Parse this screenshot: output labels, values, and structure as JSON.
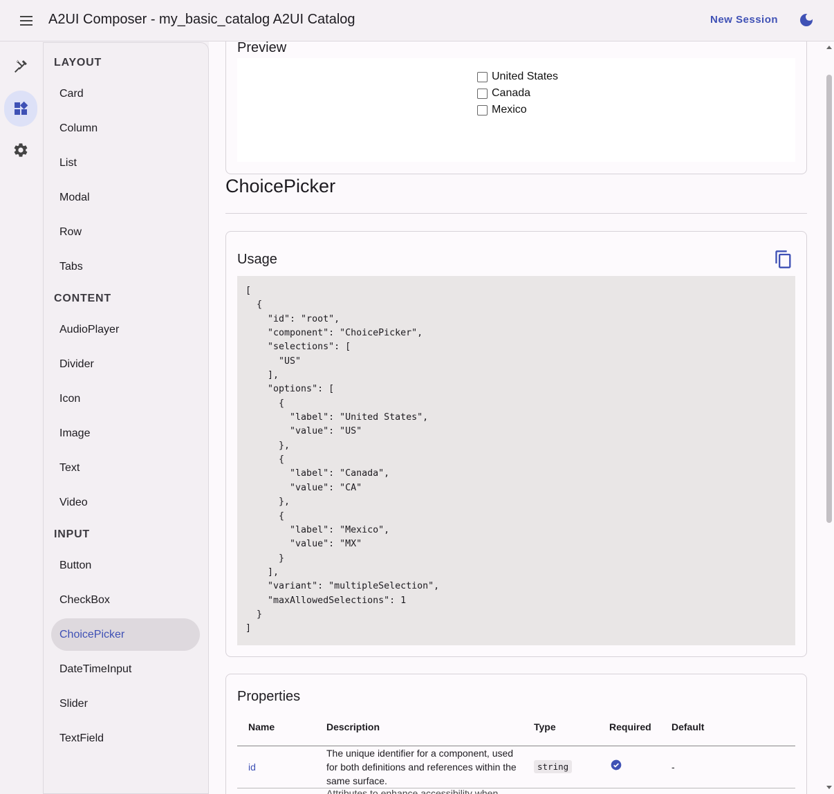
{
  "app": {
    "title": "A2UI Composer - my_basic_catalog A2UI Catalog",
    "new_session_label": "New Session",
    "menu_icon": "menu-icon",
    "theme_icon": "dark-mode-icon"
  },
  "rail": {
    "items": [
      {
        "icon": "tools-icon",
        "active": false
      },
      {
        "icon": "widgets-icon",
        "active": true
      },
      {
        "icon": "settings-icon",
        "active": false
      }
    ]
  },
  "sidebar": {
    "sections": [
      {
        "label": "LAYOUT",
        "items": [
          "Card",
          "Column",
          "List",
          "Modal",
          "Row",
          "Tabs"
        ]
      },
      {
        "label": "CONTENT",
        "items": [
          "AudioPlayer",
          "Divider",
          "Icon",
          "Image",
          "Text",
          "Video"
        ]
      },
      {
        "label": "INPUT",
        "items": [
          "Button",
          "CheckBox",
          "ChoicePicker",
          "DateTimeInput",
          "Slider",
          "TextField"
        ]
      }
    ],
    "active_item": "ChoicePicker"
  },
  "preview": {
    "title": "Preview",
    "options": [
      "United States",
      "Canada",
      "Mexico"
    ]
  },
  "component": {
    "name": "ChoicePicker"
  },
  "usage": {
    "title": "Usage",
    "copy_icon": "copy-icon",
    "code": "[\n  {\n    \"id\": \"root\",\n    \"component\": \"ChoicePicker\",\n    \"selections\": [\n      \"US\"\n    ],\n    \"options\": [\n      {\n        \"label\": \"United States\",\n        \"value\": \"US\"\n      },\n      {\n        \"label\": \"Canada\",\n        \"value\": \"CA\"\n      },\n      {\n        \"label\": \"Mexico\",\n        \"value\": \"MX\"\n      }\n    ],\n    \"variant\": \"multipleSelection\",\n    \"maxAllowedSelections\": 1\n  }\n]"
  },
  "properties": {
    "title": "Properties",
    "headers": [
      "Name",
      "Description",
      "Type",
      "Required",
      "Default"
    ],
    "rows": [
      {
        "name": "id",
        "description": "The unique identifier for a component, used for both definitions and references within the same surface.",
        "type": "string",
        "required": true,
        "default": "-"
      }
    ],
    "next_description_partial": "Attributes to enhance accessibility when"
  },
  "colors": {
    "accent": "#3f51b5",
    "active_rail": "#dde1f7",
    "active_nav": "#ded9de"
  }
}
